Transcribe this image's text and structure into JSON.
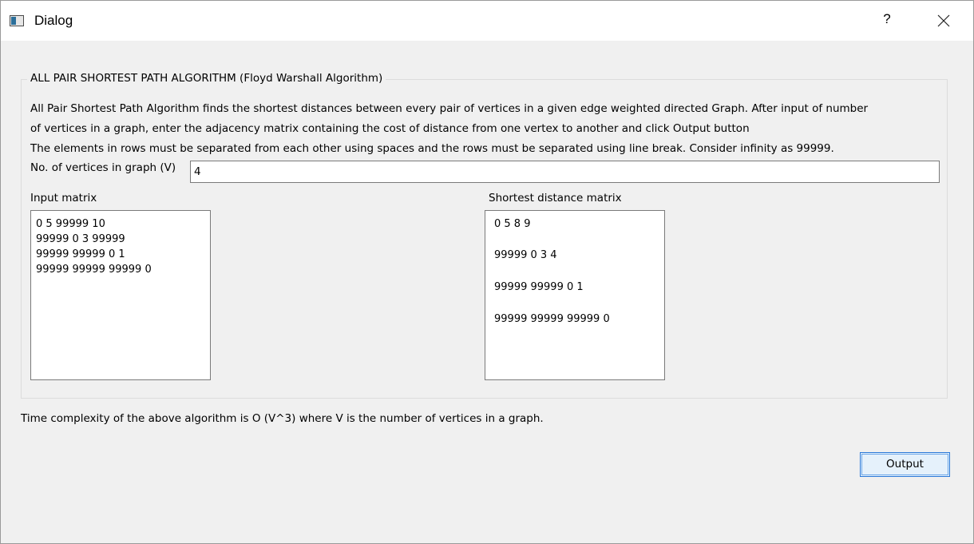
{
  "window": {
    "title": "Dialog",
    "help_label": "?"
  },
  "group": {
    "title": "ALL PAIR SHORTEST PATH ALGORITHM (Floyd Warshall Algorithm)",
    "description": [
      "All Pair Shortest Path Algorithm finds the shortest distances between every pair of vertices in a given edge weighted directed Graph. After input of  number",
      " of vertices in a graph, enter the adjacency matrix containing the cost of distance from one vertex to another and click Output button",
      "The elements in rows must be separated from each other using spaces and the rows must be separated using line break. Consider infinity as 99999."
    ],
    "vertices_label": "No. of vertices in graph (V)",
    "vertices_value": "4",
    "input_matrix_label": "Input matrix",
    "input_matrix_lines": [
      "0 5 99999 10",
      "99999 0 3 99999",
      "99999 99999 0 1",
      "99999 99999 99999 0"
    ],
    "output_matrix_label": "Shortest distance matrix",
    "output_matrix_lines": [
      "0 5 8 9",
      "99999 0 3 4",
      "99999 99999 0 1",
      "99999 99999 99999 0"
    ]
  },
  "complexity_text": "Time complexity of the above algorithm is O (V^3) where V is the number of vertices in a graph.",
  "output_button_label": "Output",
  "colors": {
    "dialog_bg": "#f0f0f0",
    "titlebar_bg": "#ffffff",
    "button_border": "#2b79d8",
    "button_bg": "#e5f1fb"
  }
}
